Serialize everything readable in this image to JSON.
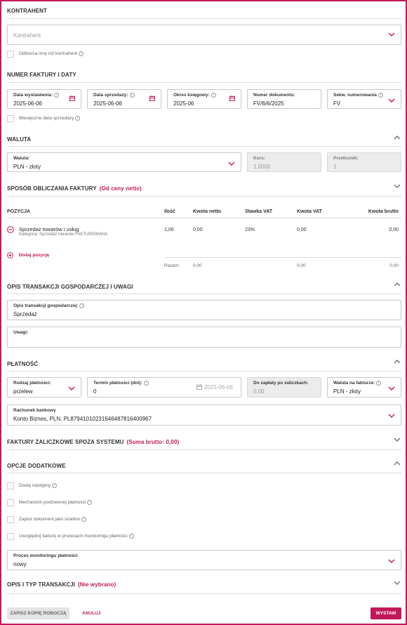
{
  "colors": {
    "accent": "#c2185b",
    "border": "#c8c8c8",
    "readonly_bg": "#ececec"
  },
  "contractor": {
    "section_title": "KONTRAHENT",
    "placeholder": "Kontrahent",
    "other_recipient": "Odbiorca inny niż kontrahent"
  },
  "dates": {
    "section_title": "NUMER FAKTURY I DATY",
    "issue_date_label": "Data wystawienia:",
    "issue_date": "2025-06-06",
    "sale_date_label": "Data sprzedaży:",
    "sale_date": "2025-06-06",
    "period_label": "Okres księgowy:",
    "period": "2025-06",
    "doc_number_label": "Numer dokumentu:",
    "doc_number": "FV/6/6/2025",
    "numbering_label": "Sekw. numerowania",
    "numbering": "FV",
    "monthly_sale_date": "Miesięczne data sprzedaży"
  },
  "currency": {
    "section_title": "WALUTA",
    "currency_label": "Waluta:",
    "currency": "PLN - złoty",
    "rate_label": "Kurs:",
    "rate": "1.0000",
    "converter_label": "Przelicznik:",
    "converter": "1"
  },
  "calc": {
    "section_title": "SPOSÓB OBLICZANIA FAKTURY",
    "mode": "(Od ceny netto)"
  },
  "positions": {
    "headers": {
      "item": "POZYCJA",
      "qty": "Ilość",
      "net": "Kwota netto",
      "vat_rate": "Stawka VAT",
      "vat": "Kwota VAT",
      "gross": "Kwota brutto"
    },
    "rows": [
      {
        "name": "Sprzedaż towarów i usług",
        "category": "Kategoria: Sprzedaż towarów FAKTUROWANA",
        "qty": "1,00",
        "net": "0,00",
        "vat_rate": "23%",
        "vat": "0,00",
        "gross": "0,00"
      }
    ],
    "add_label": "Dodaj pozycję",
    "totals": {
      "label": "Razem:",
      "net": "0,00",
      "vat": "0,00",
      "gross": "0,00"
    }
  },
  "description": {
    "section_title": "OPIS TRANSAKCJI GOSPODARCZEJ I UWAGI",
    "desc_label": "Opis transakcji gospodarczej:",
    "desc": "Sprzedaż",
    "notes_label": "Uwagi:",
    "notes": ""
  },
  "payment": {
    "section_title": "PŁATNOŚĆ",
    "type_label": "Rodzaj płatności:",
    "type": "przelew",
    "term_label": "Termin płatności (dni):",
    "term": "0",
    "term_date": "2025-06-06",
    "after_advance_label": "Do zapłaty po zaliczkach:",
    "after_advance": "0.00",
    "invoice_currency_label": "Waluta na fakturze:",
    "invoice_currency": "PLN - złoty",
    "bank_label": "Rachunek bankowy",
    "bank": "Konto Biznes, PLN, PL87941010231646487816400967"
  },
  "advance": {
    "section_title": "FAKTURY ZALICZKOWE SPOZA SYSTEMU",
    "summary": "(Suma brutto: 0,00)"
  },
  "options": {
    "section_title": "OPCJE DODATKOWE",
    "add_next": "Dodaj następny",
    "split_payment": "Mechanizm podzielonej płatności",
    "save_template": "Zapisz dokument jako szablon",
    "monitoring_include": "Uwzględnij fakturę w procesach monitoringu płatności",
    "monitoring_label": "Proces monitoringu płatności",
    "monitoring": "nowy"
  },
  "transaction": {
    "section_title": "OPIS I TYP TRANSAKCJI",
    "status": "(Nie wybrano)"
  },
  "footer": {
    "draft": "ZAPISZ KOPIĘ ROBOCZĄ",
    "cancel": "ANULUJ",
    "issue": "WYSTAW"
  }
}
